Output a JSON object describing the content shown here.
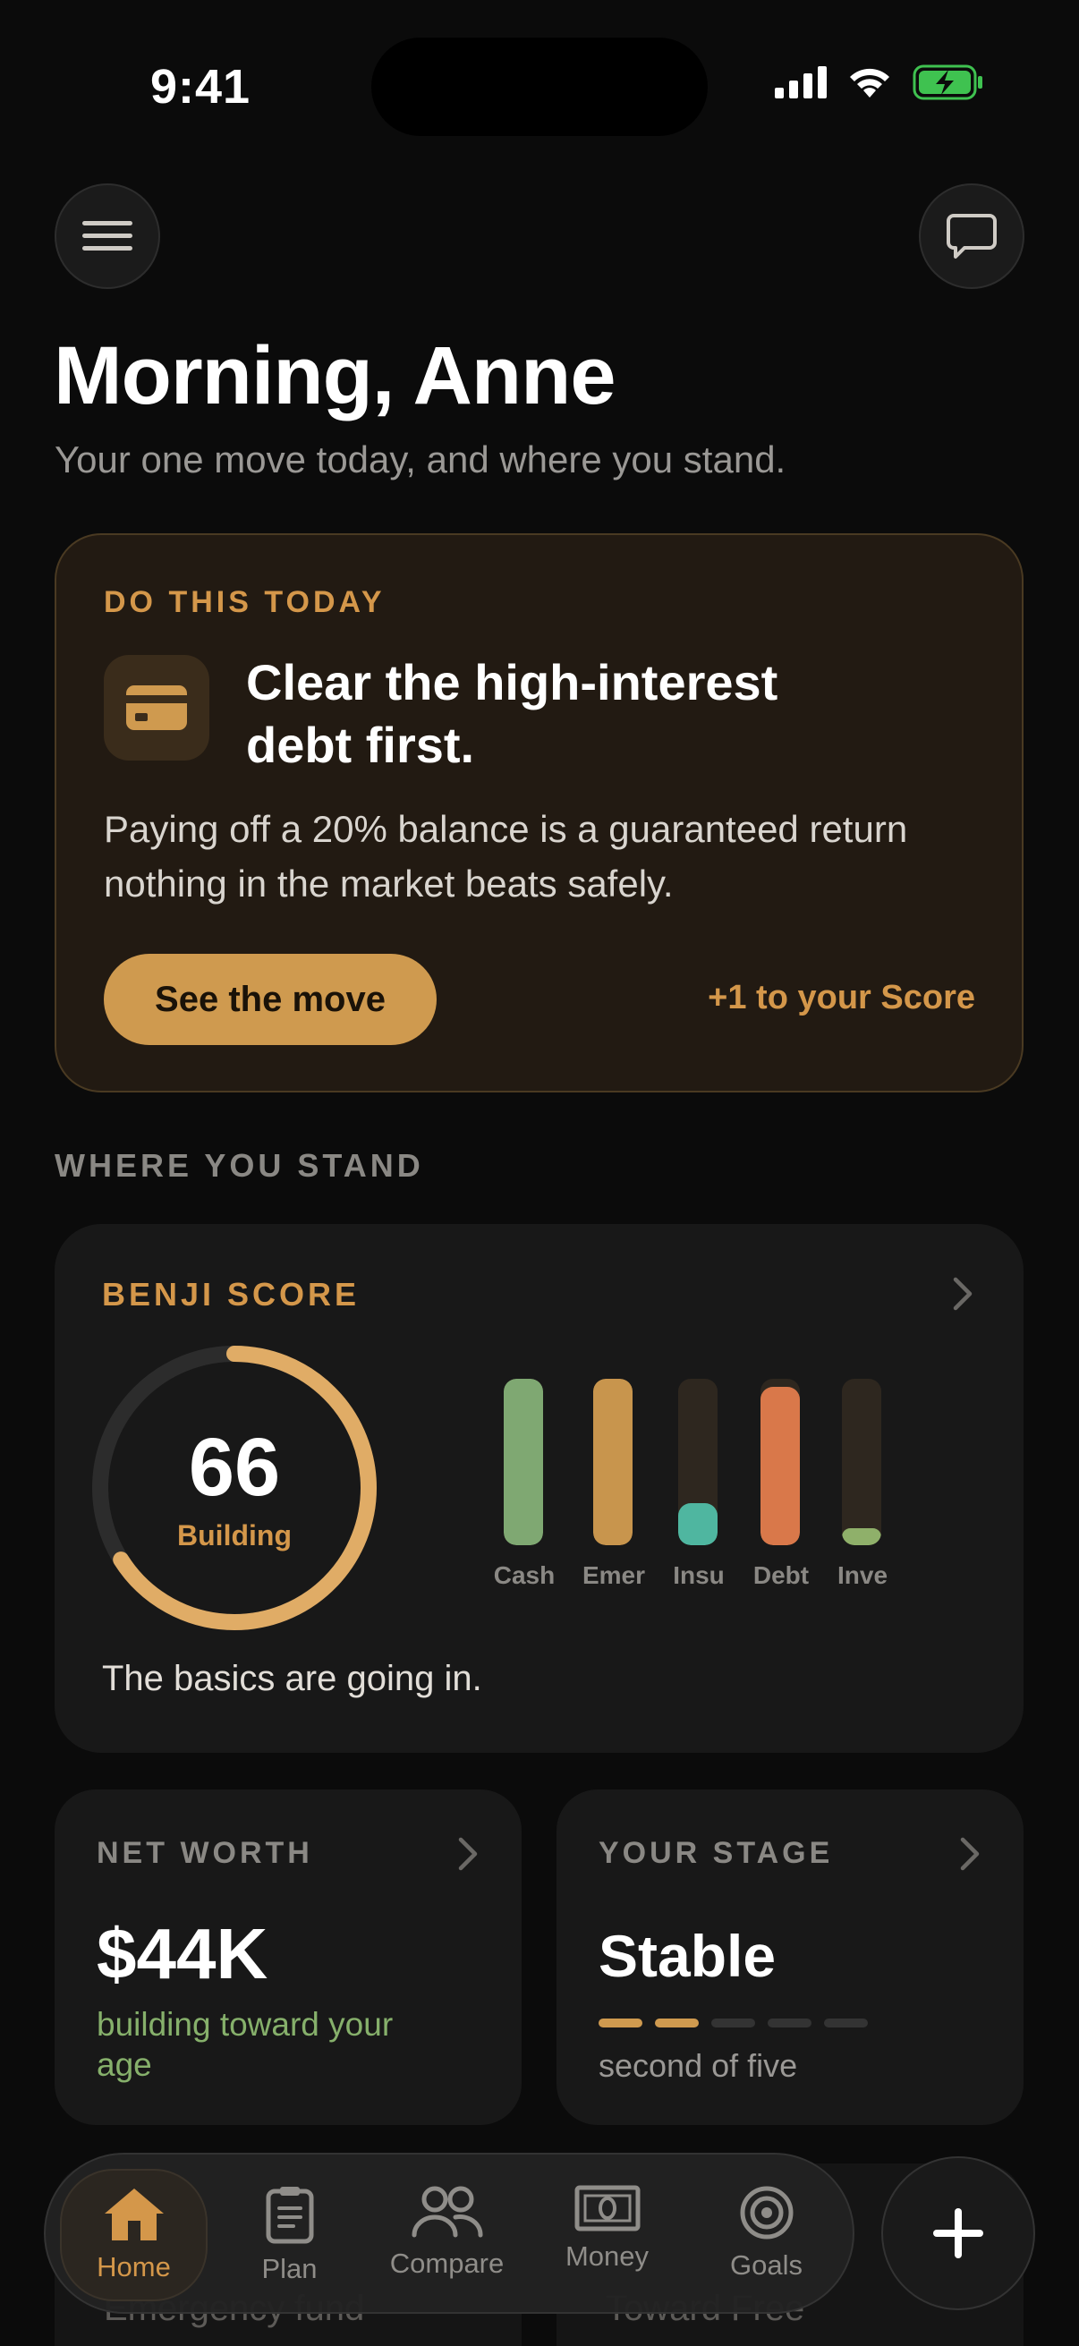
{
  "status_bar": {
    "time": "9:41"
  },
  "header": {
    "menu_icon": "hamburger-menu-icon",
    "chat_icon": "chat-bubble-icon",
    "greeting": "Morning, Anne",
    "subtitle": "Your one move today, and where you stand."
  },
  "today": {
    "eyebrow": "DO THIS TODAY",
    "icon": "credit-card-icon",
    "title": "Clear the high-interest debt first.",
    "body": "Paying off a 20% balance is a guaranteed return nothing in the market beats safely.",
    "button_label": "See the move",
    "score_gain": "+1 to your Score"
  },
  "standing": {
    "section_label": "WHERE YOU STAND",
    "score_card": {
      "eyebrow": "BENJI SCORE",
      "score": "66",
      "score_value": 66,
      "score_max": 100,
      "status": "Building",
      "note": "The basics are going in.",
      "pillars": [
        {
          "label": "Cash",
          "level": 1.0,
          "color": "#7fa872"
        },
        {
          "label": "Emer",
          "level": 1.0,
          "color": "#c8954d"
        },
        {
          "label": "Insu",
          "level": 0.25,
          "color": "#4fb6a0"
        },
        {
          "label": "Debt",
          "level": 0.95,
          "color": "#d9784a"
        },
        {
          "label": "Inve",
          "level": 0.1,
          "color": "#8fb06a"
        }
      ]
    },
    "net_worth": {
      "eyebrow": "NET WORTH",
      "value": "$44K",
      "note": "building toward your age"
    },
    "stage": {
      "eyebrow": "YOUR STAGE",
      "value": "Stable",
      "current_step": 2,
      "total_steps": 5,
      "note": "second of five"
    },
    "peek_left": "Emergency fund",
    "peek_right": "Toward Free"
  },
  "tabbar": {
    "tabs": [
      {
        "label": "Home",
        "icon": "home-icon"
      },
      {
        "label": "Plan",
        "icon": "clipboard-icon"
      },
      {
        "label": "Compare",
        "icon": "people-icon"
      },
      {
        "label": "Money",
        "icon": "banknote-icon"
      },
      {
        "label": "Goals",
        "icon": "target-icon"
      }
    ],
    "active": "Home",
    "fab_icon": "plus-icon"
  },
  "colors": {
    "accent": "#d4974a",
    "background": "#0b0b0b",
    "card": "#181818",
    "positive": "#86b06b"
  }
}
